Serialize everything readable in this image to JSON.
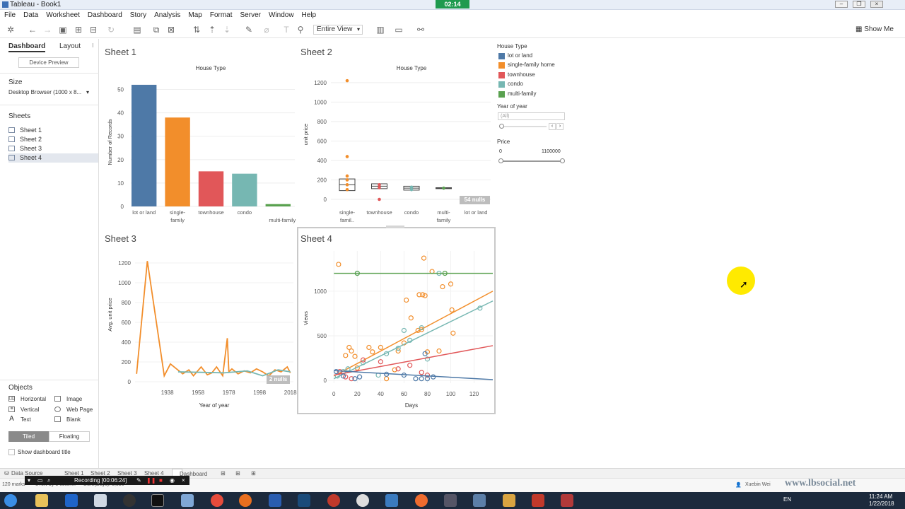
{
  "window": {
    "title": "Tableau - Book1",
    "recording_timer": "02:14"
  },
  "menu": [
    "File",
    "Data",
    "Worksheet",
    "Dashboard",
    "Story",
    "Analysis",
    "Map",
    "Format",
    "Server",
    "Window",
    "Help"
  ],
  "toolbar": {
    "view_select": "Entire View",
    "show_me": "Show Me"
  },
  "left_pane": {
    "tabs": [
      "Dashboard",
      "Layout"
    ],
    "device_preview": "Device Preview",
    "size_label": "Size",
    "size_value": "Desktop Browser (1000 x 8...",
    "sheets_label": "Sheets",
    "sheets": [
      "Sheet 1",
      "Sheet 2",
      "Sheet 3",
      "Sheet 4"
    ],
    "objects_label": "Objects",
    "objects": [
      "Horizontal",
      "Image",
      "Vertical",
      "Web Page",
      "Text",
      "Blank"
    ],
    "tiled": "Tiled",
    "floating": "Floating",
    "show_title": "Show dashboard title"
  },
  "legend": {
    "title": "House Type",
    "items": [
      {
        "label": "lot or land",
        "color": "#4e79a7"
      },
      {
        "label": "single-family home",
        "color": "#f28e2b"
      },
      {
        "label": "townhouse",
        "color": "#e15759"
      },
      {
        "label": "condo",
        "color": "#76b7b2"
      },
      {
        "label": "multi-family",
        "color": "#59a14f"
      }
    ]
  },
  "filters": {
    "year_label": "Year of year",
    "year_value": "(All)",
    "price_label": "Price",
    "price_min": "0",
    "price_max": "1100000"
  },
  "sheets": {
    "s1": {
      "title": "Sheet 1"
    },
    "s2": {
      "title": "Sheet 2",
      "nulls": "54 nulls"
    },
    "s3": {
      "title": "Sheet 3",
      "nulls": "2 nulls"
    },
    "s4": {
      "title": "Sheet 4"
    }
  },
  "chart_data": [
    {
      "type": "bar",
      "title": "House Type",
      "ylabel": "Number of Records",
      "categories": [
        "lot or land",
        "single-family",
        "townhouse",
        "condo",
        "multi-family"
      ],
      "values": [
        52,
        38,
        15,
        14,
        1
      ],
      "colors": [
        "#4e79a7",
        "#f28e2b",
        "#e15759",
        "#76b7b2",
        "#59a14f"
      ],
      "yticks": [
        0,
        10,
        20,
        30,
        40,
        50
      ],
      "ylim": [
        0,
        55
      ]
    },
    {
      "type": "scatter",
      "title": "House Type",
      "ylabel": "unit price",
      "categories": [
        "single-famil..",
        "townhouse",
        "condo",
        "multi-family",
        "lot or land"
      ],
      "yticks": [
        0,
        200,
        400,
        600,
        800,
        1000,
        1200
      ],
      "ylim": [
        0,
        1250
      ],
      "points": [
        {
          "cat": 0,
          "y": 1220,
          "color": "#f28e2b"
        },
        {
          "cat": 0,
          "y": 440,
          "color": "#f28e2b"
        },
        {
          "cat": 0,
          "y": 240,
          "color": "#f28e2b"
        },
        {
          "cat": 0,
          "y": 200,
          "color": "#f28e2b"
        },
        {
          "cat": 0,
          "y": 150,
          "color": "#f28e2b"
        },
        {
          "cat": 0,
          "y": 100,
          "color": "#f28e2b"
        },
        {
          "cat": 1,
          "y": 150,
          "color": "#e15759"
        },
        {
          "cat": 1,
          "y": 120,
          "color": "#e15759"
        },
        {
          "cat": 1,
          "y": 0,
          "color": "#e15759"
        },
        {
          "cat": 2,
          "y": 125,
          "color": "#76b7b2"
        },
        {
          "cat": 2,
          "y": 100,
          "color": "#76b7b2"
        },
        {
          "cat": 3,
          "y": 115,
          "color": "#59a14f"
        }
      ],
      "boxes": [
        {
          "cat": 0,
          "lo": 90,
          "hi": 210
        },
        {
          "cat": 1,
          "lo": 110,
          "hi": 160
        },
        {
          "cat": 2,
          "lo": 95,
          "hi": 135
        },
        {
          "cat": 3,
          "lo": 110,
          "hi": 120
        }
      ]
    },
    {
      "type": "line",
      "xlabel": "Year of year",
      "ylabel": "Avg. unit price",
      "xticks": [
        1938,
        1958,
        1978,
        1998,
        2018
      ],
      "yticks": [
        0,
        200,
        400,
        600,
        800,
        1000,
        1200
      ],
      "xlim": [
        1917,
        2020
      ],
      "ylim": [
        0,
        1250
      ],
      "series": [
        {
          "color": "#f28e2b",
          "x": [
            1918,
            1925,
            1936,
            1940,
            1944,
            1948,
            1952,
            1955,
            1960,
            1964,
            1967,
            1970,
            1974,
            1977,
            1978,
            1980,
            1984,
            1988,
            1992,
            1996,
            2000,
            2004,
            2008,
            2012,
            2016,
            2018
          ],
          "y": [
            80,
            1220,
            60,
            180,
            130,
            80,
            120,
            60,
            150,
            70,
            90,
            150,
            60,
            440,
            100,
            130,
            80,
            110,
            90,
            130,
            100,
            60,
            120,
            100,
            150,
            90
          ]
        },
        {
          "color": "#76b7b2",
          "x": [
            1945,
            1960,
            1975,
            1990,
            2000,
            2010,
            2018
          ],
          "y": [
            100,
            95,
            90,
            110,
            60,
            120,
            100
          ]
        }
      ]
    },
    {
      "type": "scatter",
      "xlabel": "Days",
      "ylabel": "Views",
      "xticks": [
        0,
        20,
        40,
        60,
        80,
        100,
        120
      ],
      "yticks": [
        0,
        500,
        1000
      ],
      "xlim": [
        -5,
        136
      ],
      "ylim": [
        -30,
        1450
      ],
      "series": [
        {
          "name": "single-family home",
          "color": "#f28e2b",
          "x": [
            4,
            10,
            13,
            15,
            18,
            20,
            30,
            33,
            40,
            45,
            52,
            55,
            60,
            62,
            66,
            72,
            73,
            75,
            76,
            77,
            78,
            80,
            84,
            90,
            93,
            100,
            101,
            102
          ],
          "y": [
            1300,
            280,
            370,
            330,
            270,
            140,
            370,
            320,
            370,
            20,
            120,
            330,
            420,
            900,
            700,
            560,
            960,
            570,
            960,
            1370,
            950,
            320,
            1220,
            330,
            1050,
            1080,
            790,
            530
          ],
          "trend": [
            [
              0,
              50
            ],
            [
              136,
              1000
            ]
          ]
        },
        {
          "name": "condo",
          "color": "#76b7b2",
          "x": [
            3,
            8,
            12,
            20,
            25,
            38,
            45,
            55,
            60,
            65,
            75,
            80,
            90,
            125
          ],
          "y": [
            50,
            100,
            130,
            1200,
            200,
            60,
            300,
            360,
            560,
            450,
            590,
            240,
            1200,
            810
          ],
          "trend": [
            [
              0,
              20
            ],
            [
              136,
              890
            ]
          ]
        },
        {
          "name": "townhouse",
          "color": "#e15759",
          "x": [
            5,
            10,
            15,
            25,
            40,
            55,
            65,
            75,
            80
          ],
          "y": [
            100,
            40,
            20,
            230,
            210,
            130,
            170,
            90,
            60
          ],
          "trend": [
            [
              0,
              60
            ],
            [
              136,
              390
            ]
          ]
        },
        {
          "name": "lot or land",
          "color": "#4e79a7",
          "x": [
            2,
            8,
            18,
            22,
            45,
            60,
            70,
            75,
            78,
            80,
            85
          ],
          "y": [
            100,
            50,
            20,
            40,
            70,
            60,
            20,
            20,
            300,
            20,
            40
          ],
          "trend": [
            [
              0,
              110
            ],
            [
              136,
              10
            ]
          ]
        },
        {
          "name": "multi-family",
          "color": "#59a14f",
          "x": [
            20,
            95
          ],
          "y": [
            1200,
            1200
          ],
          "trend": [
            [
              0,
              1200
            ],
            [
              136,
              1200
            ]
          ]
        }
      ]
    }
  ],
  "bottom_tabs": [
    "Data Source",
    "Sheet 1",
    "Sheet 2",
    "Sheet 3",
    "Sheet 4",
    "Dashboard 1"
  ],
  "status": {
    "marks": "120 marks",
    "rows": "1 row by 1 column",
    "sum": "SUM(Days): 8,590",
    "user": "Xuebin Wei"
  },
  "recording": "Recording [00:06:24]",
  "watermark": "www.lbsocial.net",
  "clock": {
    "time": "11:24 AM",
    "date": "1/22/2018",
    "lang": "EN"
  }
}
